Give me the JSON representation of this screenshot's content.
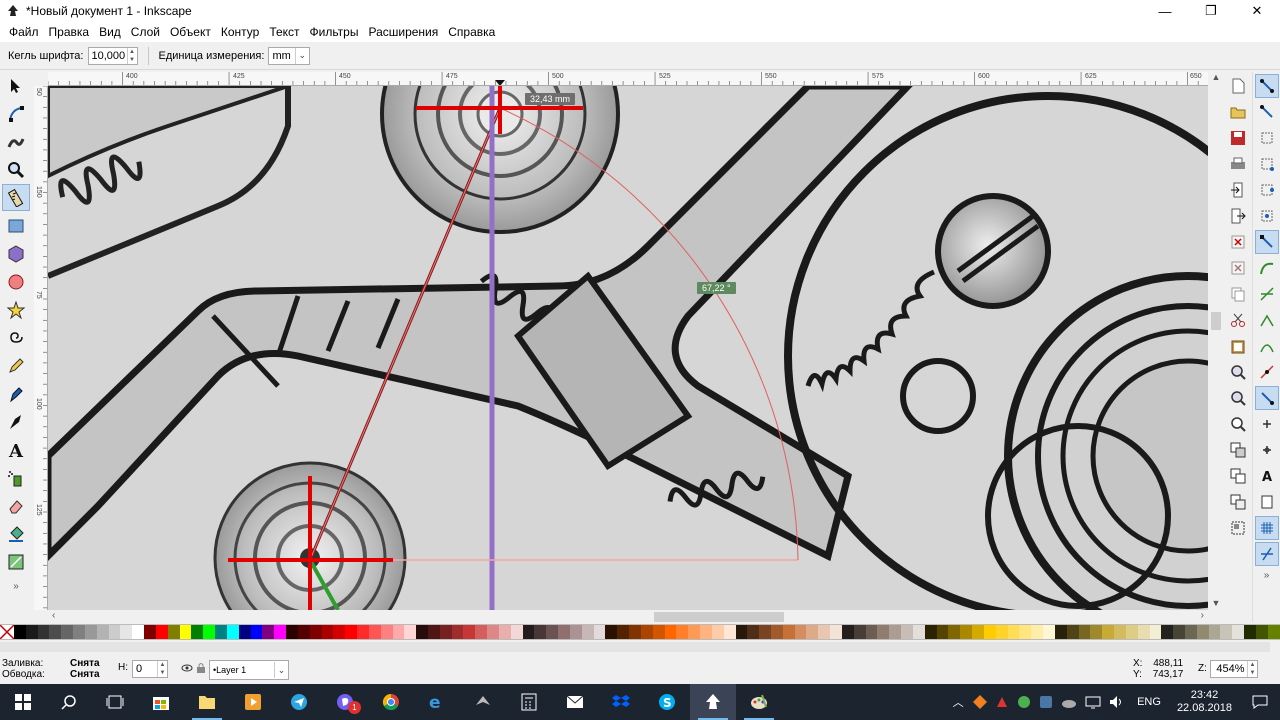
{
  "window": {
    "title": "*Новый документ 1 - Inkscape",
    "minimize": "—",
    "maximize": "❐",
    "close": "✕"
  },
  "menu": [
    "Файл",
    "Правка",
    "Вид",
    "Слой",
    "Объект",
    "Контур",
    "Текст",
    "Фильтры",
    "Расширения",
    "Справка"
  ],
  "tool_controls": {
    "font_size_label": "Кегль шрифта:",
    "font_size_value": "10,000",
    "unit_label": "Единица измерения:",
    "unit_value": "mm"
  },
  "tools": [
    "selector-icon",
    "node-editor-icon",
    "tweak-icon",
    "zoom-icon",
    "measure-icon",
    "rectangle-icon",
    "3d-box-icon",
    "ellipse-icon",
    "star-icon",
    "spiral-icon",
    "pencil-icon",
    "pen-icon",
    "calligraphy-icon",
    "text-icon",
    "spray-icon",
    "eraser-icon",
    "bucket-icon",
    "gradient-icon"
  ],
  "active_tool": "measure-icon",
  "ruler": {
    "h_ticks": [
      "400",
      "425",
      "450",
      "475",
      "500",
      "525",
      "550",
      "575",
      "600",
      "625",
      "650"
    ],
    "v_ticks": [
      "50",
      "75",
      "100",
      "125",
      "150"
    ]
  },
  "measure": {
    "length_label": "32,43 mm",
    "angle_label": "67,22 °"
  },
  "statusbar": {
    "fill_label": "Заливка:",
    "fill_value": "Снята",
    "stroke_label": "Обводка:",
    "stroke_value": "Снята",
    "h_label": "H:",
    "h_value": "0",
    "layer_value": "•Layer 1",
    "x_label": "X:",
    "x_value": "488,11",
    "y_label": "Y:",
    "y_value": "743,17",
    "zoom_label": "Z:",
    "zoom_value": "454%"
  },
  "taskbar": {
    "language": "ENG",
    "time": "23:42",
    "date": "22.08.2018",
    "chat_badge": "1"
  },
  "palette": [
    "#000000",
    "#1a1a1a",
    "#333333",
    "#4d4d4d",
    "#666666",
    "#808080",
    "#999999",
    "#b3b3b3",
    "#cccccc",
    "#e6e6e6",
    "#ffffff",
    "#800000",
    "#ff0000",
    "#808000",
    "#ffff00",
    "#008000",
    "#00ff00",
    "#008080",
    "#00ffff",
    "#000080",
    "#0000ff",
    "#800080",
    "#ff00ff",
    "#2b0000",
    "#550000",
    "#800000",
    "#aa0000",
    "#d40000",
    "#ff0000",
    "#ff2a2a",
    "#ff5555",
    "#ff8080",
    "#ffaaaa",
    "#ffd5d5",
    "#280b0b",
    "#501616",
    "#782121",
    "#a02c2c",
    "#c83737",
    "#d35f5f",
    "#de8787",
    "#e9afaf",
    "#f4d7d7",
    "#241c1c",
    "#483737",
    "#6c5353",
    "#916f6f",
    "#ac9393",
    "#c8b7b7",
    "#e3dbdb",
    "#2b1100",
    "#552200",
    "#803300",
    "#aa4400",
    "#d45500",
    "#ff6600",
    "#ff7f2a",
    "#ff9955",
    "#ffb380",
    "#ffccaa",
    "#ffe6d5",
    "#28170b",
    "#502d16",
    "#784421",
    "#a05a2c",
    "#c87137",
    "#d38d5f",
    "#deaa87",
    "#e9c6af",
    "#f4e3d7",
    "#241f1c",
    "#483e37",
    "#6c5d53",
    "#917c6f",
    "#ac9d93",
    "#c8beb7",
    "#e3dedb",
    "#2b2200",
    "#554400",
    "#806600",
    "#aa8800",
    "#d4aa00",
    "#ffcc00",
    "#ffd42a",
    "#ffdd55",
    "#ffe680",
    "#ffeeaa",
    "#fff6d5",
    "#28220b",
    "#504416",
    "#786721",
    "#a0892c",
    "#c8ab37",
    "#d3bc5f",
    "#decd87",
    "#e9ddaf",
    "#f4eed7",
    "#24221c",
    "#484537",
    "#6c6753",
    "#918a6f",
    "#aca793",
    "#c8c4b7",
    "#e3e2db",
    "#222b00",
    "#445500",
    "#668000"
  ]
}
